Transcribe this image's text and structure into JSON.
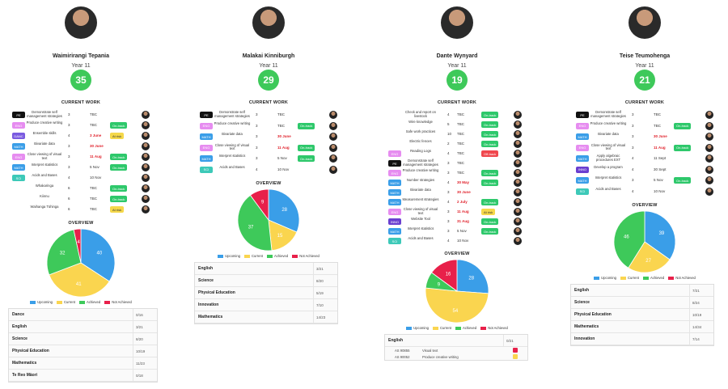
{
  "colors": {
    "upcoming": "#3a9ee8",
    "current": "#fad54f",
    "achieved": "#3ec95a",
    "not_achieved": "#e8204a",
    "score": "#3ec95a",
    "on_track": "#2ec86b",
    "at_risk": "#f5d84a",
    "off_track": "#f0474d"
  },
  "labels": {
    "current_work": "CURRENT WORK",
    "overview": "OVERVIEW",
    "legend": [
      "Upcoming",
      "Current",
      "Achieved",
      "Not Achieved"
    ]
  },
  "students": [
    {
      "name": "Waimirirangi Tepania",
      "year": "Year 11",
      "score": "35",
      "work": [
        {
          "subject": "PE",
          "subject_color": "#111111",
          "desc": "Demonstrate self management strategies",
          "level": "3",
          "due": "TBC",
          "late": false,
          "status": "",
          "status_kind": ""
        },
        {
          "subject": "ENG",
          "subject_color": "#e68cf0",
          "desc": "Produce creative writing",
          "level": "3",
          "due": "TBC",
          "late": false,
          "status": "On-track",
          "status_kind": "on"
        },
        {
          "subject": "DANC",
          "subject_color": "#7a5be0",
          "desc": "Ensemble skills",
          "level": "4",
          "due": "3 June",
          "late": true,
          "status": "At risk",
          "status_kind": "risk"
        },
        {
          "subject": "MATH",
          "subject_color": "#3a9ee8",
          "desc": "Bivariate data",
          "level": "3",
          "due": "30 June",
          "late": true,
          "status": "",
          "status_kind": ""
        },
        {
          "subject": "ENG",
          "subject_color": "#e68cf0",
          "desc": "Close viewing of visual text",
          "level": "3",
          "due": "11 Aug",
          "late": true,
          "status": "On-track",
          "status_kind": "on"
        },
        {
          "subject": "MATH",
          "subject_color": "#3a9ee8",
          "desc": "Interpret statistics",
          "level": "3",
          "due": "5 Nov",
          "late": false,
          "status": "On-track",
          "status_kind": "on"
        },
        {
          "subject": "SCI",
          "subject_color": "#3dc9b8",
          "desc": "Acids and Bases",
          "level": "4",
          "due": "10 Nov",
          "late": false,
          "status": "",
          "status_kind": ""
        },
        {
          "subject": "",
          "subject_color": "",
          "desc": "Whakaringa",
          "level": "6",
          "due": "TBC",
          "late": false,
          "status": "On-track",
          "status_kind": "on"
        },
        {
          "subject": "",
          "subject_color": "",
          "desc": "Kiinnu",
          "level": "6",
          "due": "TBC",
          "late": false,
          "status": "On-track",
          "status_kind": "on"
        },
        {
          "subject": "",
          "subject_color": "",
          "desc": "Waihanga Tühinga",
          "level": "6",
          "due": "TBC",
          "late": false,
          "status": "At risk",
          "status_kind": "risk"
        }
      ],
      "overview": {
        "upcoming": 40,
        "current": 41,
        "achieved": 32,
        "not_achieved": 4
      },
      "table": [
        {
          "name": "Dance",
          "value": "0/16"
        },
        {
          "name": "English",
          "value": "3/21"
        },
        {
          "name": "Science",
          "value": "8/20"
        },
        {
          "name": "Physical Education",
          "value": "10/19"
        },
        {
          "name": "Mathematics",
          "value": "11/23"
        },
        {
          "name": "Te Reo Mäori",
          "value": "0/18"
        }
      ]
    },
    {
      "name": "Malakai Kinniburgh",
      "year": "Year 11",
      "score": "29",
      "work": [
        {
          "subject": "PE",
          "subject_color": "#111111",
          "desc": "Demonstrate self management strategies",
          "level": "3",
          "due": "TBC",
          "late": false,
          "status": "",
          "status_kind": ""
        },
        {
          "subject": "ENG",
          "subject_color": "#e68cf0",
          "desc": "Produce creative writing",
          "level": "3",
          "due": "TBC",
          "late": false,
          "status": "On-track",
          "status_kind": "on"
        },
        {
          "subject": "MATH",
          "subject_color": "#3a9ee8",
          "desc": "Bivariate data",
          "level": "3",
          "due": "30 June",
          "late": true,
          "status": "",
          "status_kind": ""
        },
        {
          "subject": "ENG",
          "subject_color": "#e68cf0",
          "desc": "Close viewing of visual text",
          "level": "3",
          "due": "11 Aug",
          "late": true,
          "status": "On-track",
          "status_kind": "on"
        },
        {
          "subject": "MATH",
          "subject_color": "#3a9ee8",
          "desc": "Interpret statistics",
          "level": "3",
          "due": "5 Nov",
          "late": false,
          "status": "On-track",
          "status_kind": "on"
        },
        {
          "subject": "SCI",
          "subject_color": "#3dc9b8",
          "desc": "Acids and Bases",
          "level": "4",
          "due": "10 Nov",
          "late": false,
          "status": "",
          "status_kind": ""
        }
      ],
      "overview": {
        "upcoming": 28,
        "current": 15,
        "achieved": 37,
        "not_achieved": 9
      },
      "table": [
        {
          "name": "English",
          "value": "3/21"
        },
        {
          "name": "Science",
          "value": "8/20"
        },
        {
          "name": "Physical Education",
          "value": "5/19"
        },
        {
          "name": "Innovation",
          "value": "7/10"
        },
        {
          "name": "Mathematics",
          "value": "14/23"
        }
      ]
    },
    {
      "name": "Dante Wynyard",
      "year": "Year 11",
      "score": "19",
      "work": [
        {
          "subject": "",
          "subject_color": "",
          "desc": "Check and report on livestock",
          "level": "4",
          "due": "TBC",
          "late": false,
          "status": "On-track",
          "status_kind": "on"
        },
        {
          "subject": "",
          "subject_color": "",
          "desc": "Wire knowledge",
          "level": "5",
          "due": "TBC",
          "late": false,
          "status": "On-track",
          "status_kind": "on"
        },
        {
          "subject": "",
          "subject_color": "",
          "desc": "Safe work practices",
          "level": "10",
          "due": "TBC",
          "late": false,
          "status": "On-track",
          "status_kind": "on"
        },
        {
          "subject": "",
          "subject_color": "",
          "desc": "Electric fences",
          "level": "2",
          "due": "TBC",
          "late": false,
          "status": "On-track",
          "status_kind": "on"
        },
        {
          "subject": "ENG",
          "subject_color": "#e68cf0",
          "desc": "Reading Logs",
          "level": "4",
          "due": "TBC",
          "late": false,
          "status": "Off-track",
          "status_kind": "off"
        },
        {
          "subject": "PE",
          "subject_color": "#111111",
          "desc": "Demonstrate self management strategies",
          "level": "3",
          "due": "TBC",
          "late": false,
          "status": "",
          "status_kind": ""
        },
        {
          "subject": "ENG",
          "subject_color": "#e68cf0",
          "desc": "Produce creative writing",
          "level": "3",
          "due": "TBC",
          "late": false,
          "status": "On-track",
          "status_kind": "on"
        },
        {
          "subject": "MATH",
          "subject_color": "#3a9ee8",
          "desc": "Number strategies",
          "level": "4",
          "due": "30 May",
          "late": true,
          "status": "On-track",
          "status_kind": "on"
        },
        {
          "subject": "MATH",
          "subject_color": "#3a9ee8",
          "desc": "Bivariate data",
          "level": "3",
          "due": "30 June",
          "late": true,
          "status": "",
          "status_kind": ""
        },
        {
          "subject": "MATH",
          "subject_color": "#3a9ee8",
          "desc": "Measurement strategies",
          "level": "4",
          "due": "2 July",
          "late": true,
          "status": "On-track",
          "status_kind": "on"
        },
        {
          "subject": "ENG",
          "subject_color": "#e68cf0",
          "desc": "Close viewing of visual text",
          "level": "3",
          "due": "11 Aug",
          "late": true,
          "status": "At risk",
          "status_kind": "risk"
        },
        {
          "subject": "INNO",
          "subject_color": "#6a3fd0",
          "desc": "Website Tool",
          "level": "3",
          "due": "31 Aug",
          "late": true,
          "status": "On-track",
          "status_kind": "on"
        },
        {
          "subject": "MATH",
          "subject_color": "#3a9ee8",
          "desc": "Interpret statistics",
          "level": "3",
          "due": "5 Nov",
          "late": false,
          "status": "On-track",
          "status_kind": "on"
        },
        {
          "subject": "SCI",
          "subject_color": "#3dc9b8",
          "desc": "Acids and Bases",
          "level": "4",
          "due": "10 Nov",
          "late": false,
          "status": "",
          "status_kind": ""
        }
      ],
      "overview": {
        "upcoming": 28,
        "current": 54,
        "achieved": 9,
        "not_achieved": 16
      },
      "table": [
        {
          "name": "English",
          "value": "0/21"
        }
      ],
      "subrows": [
        {
          "code": "AS 90855",
          "desc": "Visual text",
          "mark_color": "#e8204a"
        },
        {
          "code": "AS 90052",
          "desc": "Produce creative writing",
          "mark_color": "#fad54f"
        }
      ]
    },
    {
      "name": "Teise Teumohenga",
      "year": "Year 11",
      "score": "21",
      "work": [
        {
          "subject": "PE",
          "subject_color": "#111111",
          "desc": "Demonstrate self management strategies",
          "level": "3",
          "due": "TBC",
          "late": false,
          "status": "",
          "status_kind": ""
        },
        {
          "subject": "ENG",
          "subject_color": "#e68cf0",
          "desc": "Produce creative writing",
          "level": "3",
          "due": "TBC",
          "late": false,
          "status": "On-track",
          "status_kind": "on"
        },
        {
          "subject": "MATH",
          "subject_color": "#3a9ee8",
          "desc": "Bivariate data",
          "level": "3",
          "due": "30 June",
          "late": true,
          "status": "",
          "status_kind": ""
        },
        {
          "subject": "ENG",
          "subject_color": "#e68cf0",
          "desc": "Close viewing of visual text",
          "level": "3",
          "due": "11 Aug",
          "late": true,
          "status": "On-track",
          "status_kind": "on"
        },
        {
          "subject": "MATH",
          "subject_color": "#3a9ee8",
          "desc": "Apply algebraic procedures EXT",
          "level": "4",
          "due": "11 Sept",
          "late": false,
          "status": "",
          "status_kind": ""
        },
        {
          "subject": "INNO",
          "subject_color": "#6a3fd0",
          "desc": "Develop a program",
          "level": "4",
          "due": "30 Sept",
          "late": false,
          "status": "",
          "status_kind": ""
        },
        {
          "subject": "MATH",
          "subject_color": "#3a9ee8",
          "desc": "Interpret statistics",
          "level": "3",
          "due": "5 Nov",
          "late": false,
          "status": "On-track",
          "status_kind": "on"
        },
        {
          "subject": "SCI",
          "subject_color": "#3dc9b8",
          "desc": "Acids and Bases",
          "level": "4",
          "due": "10 Nov",
          "late": false,
          "status": "",
          "status_kind": ""
        }
      ],
      "overview": {
        "upcoming": 39,
        "current": 27,
        "achieved": 46,
        "not_achieved": 0
      },
      "table": [
        {
          "name": "English",
          "value": "7/21"
        },
        {
          "name": "Science",
          "value": "8/24"
        },
        {
          "name": "Physical Education",
          "value": "10/19"
        },
        {
          "name": "Mathematics",
          "value": "14/34"
        },
        {
          "name": "Innovation",
          "value": "7/14"
        }
      ]
    }
  ]
}
